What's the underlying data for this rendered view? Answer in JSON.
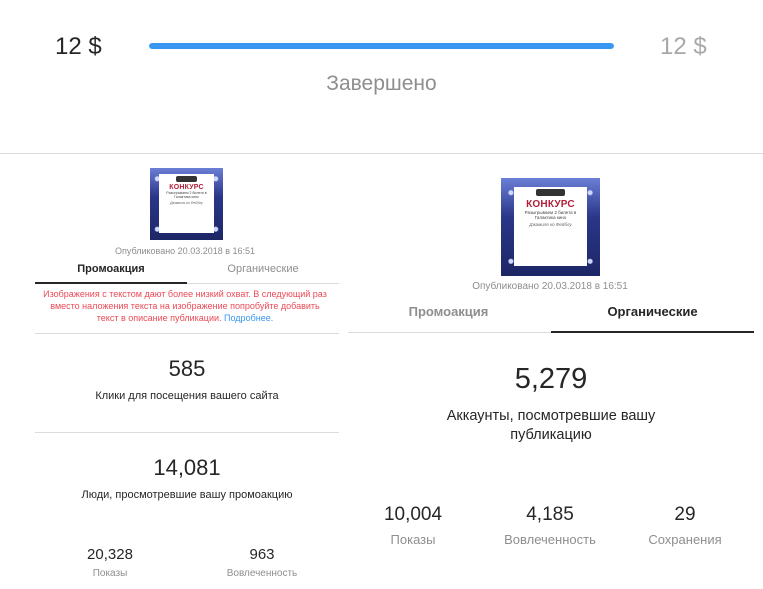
{
  "progress": {
    "spent": "12 $",
    "budget": "12 $",
    "status": "Завершено",
    "fraction": 1.0
  },
  "colors": {
    "progress_fill": "#3897f0",
    "warning": "#ed4956",
    "link": "#3897f0",
    "muted": "#8e8e8e"
  },
  "left_panel": {
    "thumbnail": {
      "title": "КОНКУРС",
      "subtitle": "Разыгрываем 2 билета в Галактика кино",
      "signature": "Джамиля ко Фейблу"
    },
    "published": "Опубликовано 20.03.2018 в 16:51",
    "tabs": [
      {
        "label": "Промоакция"
      },
      {
        "label": "Органические"
      }
    ],
    "warning": "Изображения с текстом дают более низкий охват. В следующий раз вместо наложения текста на изображение попробуйте добавить текст в описание публикации.",
    "warning_link": "Подробнее.",
    "metric1": {
      "value": "585",
      "label": "Клики для посещения вашего сайта"
    },
    "metric2": {
      "value": "14,081",
      "label": "Люди, просмотревшие вашу промоакцию"
    },
    "stats": [
      {
        "value": "20,328",
        "label": "Показы"
      },
      {
        "value": "963",
        "label": "Вовлеченность"
      }
    ]
  },
  "right_panel": {
    "thumbnail": {
      "title": "КОНКУРС",
      "subtitle": "Разыгрываем 2 билета в Галактика кино",
      "signature": "Джамиля ко Фейблу"
    },
    "published": "Опубликовано 20.03.2018 в 16:51",
    "tabs": [
      {
        "label": "Промоакция"
      },
      {
        "label": "Органические"
      }
    ],
    "metric1": {
      "value": "5,279",
      "label": "Аккаунты, посмотревшие вашу публикацию"
    },
    "stats": [
      {
        "value": "10,004",
        "label": "Показы"
      },
      {
        "value": "4,185",
        "label": "Вовлеченность"
      },
      {
        "value": "29",
        "label": "Сохранения"
      }
    ]
  }
}
